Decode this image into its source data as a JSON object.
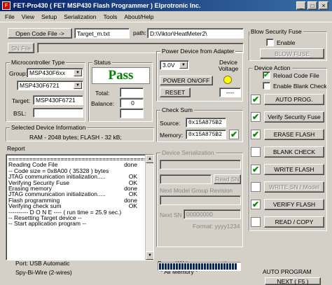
{
  "window": {
    "title": "FET-Pro430  ( FET MSP430 Flash Programmer )   Elprotronic Inc.",
    "min": "_",
    "max": "□",
    "close": "×"
  },
  "menu": [
    "File",
    "View",
    "Setup",
    "Serialization",
    "Tools",
    "About/Help"
  ],
  "code_file": {
    "open_button": "Open Code File    ->",
    "filename": "Target_m.txt",
    "path_label": "path:",
    "path": "D:\\Viktor\\HeatMeter2\\"
  },
  "sn_file": {
    "button": "SN File",
    "value": ""
  },
  "blow_fuse": {
    "title": "Blow Security Fuse",
    "enable_label": "Enable",
    "button": "BLOW FUSE"
  },
  "mcu": {
    "title": "Microcontroller Type",
    "group_label": "Group:",
    "group_value": "MSP430F6xx",
    "device_value": "MSP430F6721",
    "target_label": "Target:",
    "target_value": "MSP430F6721",
    "bsl_label": "BSL:",
    "bsl_value": ""
  },
  "status": {
    "title": "Status",
    "result": "Pass",
    "total_label": "Total:",
    "total_value": "",
    "balance_label": "Balance:",
    "balance_value": "0"
  },
  "power": {
    "title": "Power Device from Adapter",
    "voltage": "3.0V",
    "voltage_label": "Device Voltage",
    "onoff_button": "POWER ON/OFF",
    "reset_button": "RESET",
    "voltage_readout": "----",
    "led_color": "#ffff00"
  },
  "device_action": {
    "title": "Device Action",
    "reload_label": "Reload Code File",
    "blank_label": "Enable Blank Check",
    "reload_checked": "✔",
    "buttons": [
      "AUTO PROG.",
      "Verify Security Fuse",
      "ERASE FLASH",
      "BLANK CHECK",
      "WRITE FLASH",
      "WRITE SN / Model",
      "VERIFY FLASH",
      "READ / COPY"
    ],
    "checks": [
      "✔",
      "✔",
      "✔",
      "",
      "✔",
      "",
      "✔",
      ""
    ]
  },
  "checksum": {
    "title": "Check Sum",
    "source_label": "Source:",
    "source_value": "0x15A875B2",
    "memory_label": "Memory:",
    "memory_value": "0x15A875B2",
    "check": "✔"
  },
  "device_info": {
    "title": "Selected Device Information",
    "text": "RAM -  2048 bytes;      FLASH -  32 kB;"
  },
  "serialization": {
    "title": "Device Serialization",
    "read_sn": "Read SN",
    "next_model_label": "Next Model Group Revision",
    "next_sn_label": "Next SN",
    "next_sn_value": "00000000",
    "format": "Format: yyyy1234"
  },
  "report": {
    "title": "Report",
    "lines": [
      {
        "text": "========================================",
        "status": ""
      },
      {
        "text": "Reading Code File",
        "status": "done"
      },
      {
        "text": "-- Code size = 0x8A00 ( 35328 ) bytes",
        "status": ""
      },
      {
        "text": "JTAG communication initialization.....",
        "status": "OK"
      },
      {
        "text": "Verifying Security Fuse",
        "status": "OK"
      },
      {
        "text": "Erasing memory",
        "status": "done"
      },
      {
        "text": "JTAG communication initialization.....",
        "status": "OK"
      },
      {
        "text": "Flash programming",
        "status": "done"
      },
      {
        "text": "Verifying check sum",
        "status": "OK"
      },
      {
        "text": "---------- D O N E ---- ( run time = 25.9 sec.)",
        "status": ""
      },
      {
        "text": "  -- Resetting Target device --",
        "status": ""
      },
      {
        "text": "  -- Start application program --",
        "status": ""
      }
    ]
  },
  "footer": {
    "port": "Port: USB Automatic",
    "interface": "Spy-Bi-Wire (2-wires)",
    "erase_label": "Erase / Write memory option:",
    "erase_value": "* All Memory *",
    "auto_title": "AUTO PROGRAM",
    "next_button": "NEXT  ( F5 )",
    "progress": 1.0
  }
}
